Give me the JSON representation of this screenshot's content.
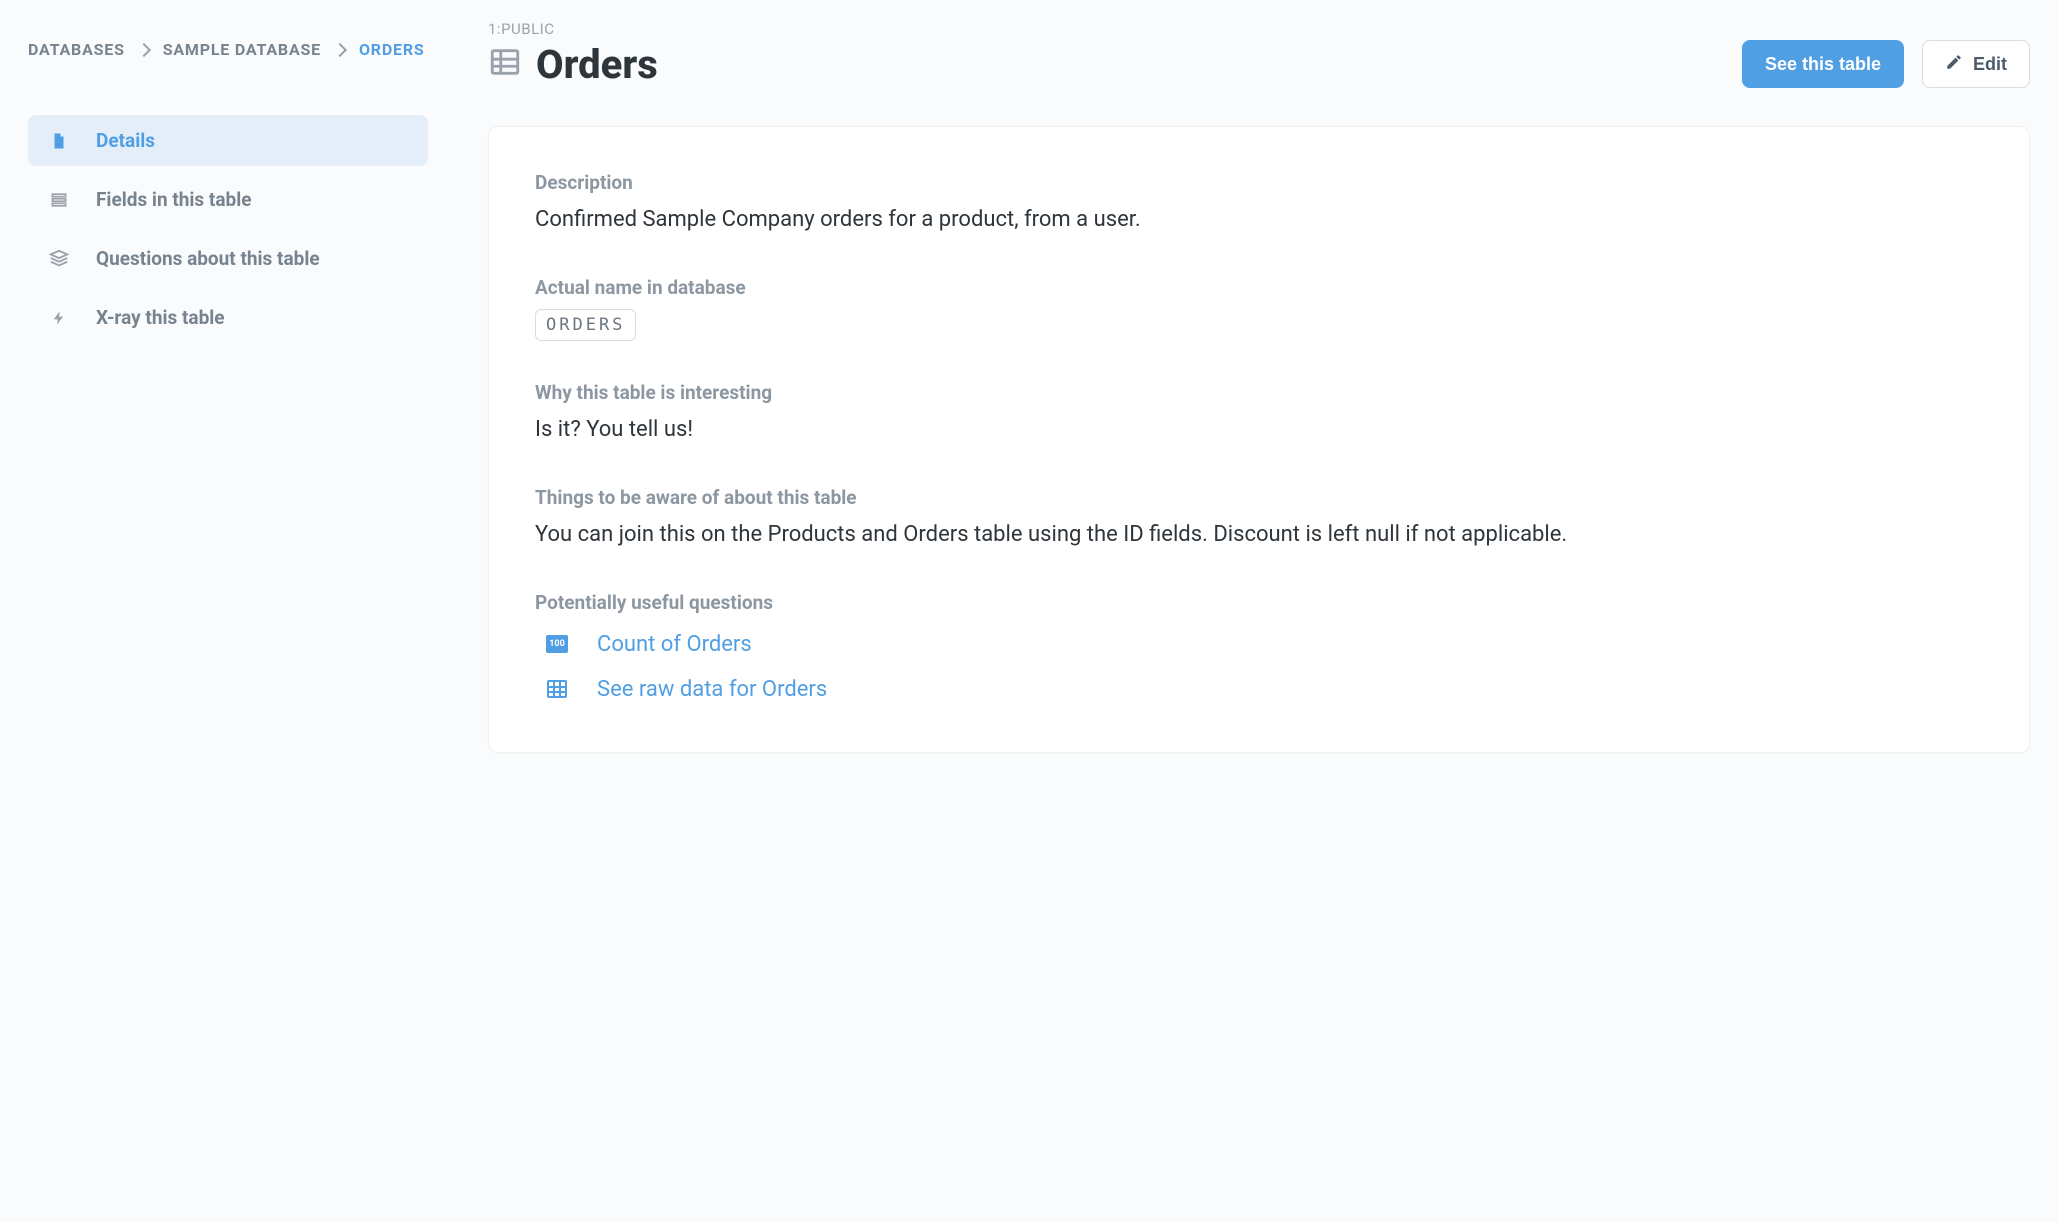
{
  "breadcrumb": {
    "items": [
      {
        "label": "DATABASES"
      },
      {
        "label": "SAMPLE DATABASE"
      },
      {
        "label": "ORDERS"
      }
    ]
  },
  "sidebar": {
    "details": "Details",
    "fields": "Fields in this table",
    "questions": "Questions about this table",
    "xray": "X-ray this table"
  },
  "header": {
    "schema": "1:PUBLIC",
    "title": "Orders",
    "see_table": "See this table",
    "edit": "Edit"
  },
  "details": {
    "description_label": "Description",
    "description_body": "Confirmed Sample Company orders for a product, from a user.",
    "actual_name_label": "Actual name in database",
    "actual_name_value": "ORDERS",
    "why_label": "Why this table is interesting",
    "why_body": "Is it? You tell us!",
    "aware_label": "Things to be aware of about this table",
    "aware_body": "You can join this on the Products and Orders table using the ID fields. Discount is left null if not applicable.",
    "useful_q_label": "Potentially useful questions",
    "questions": [
      {
        "label": "Count of Orders",
        "icon": "100"
      },
      {
        "label": "See raw data for Orders",
        "icon": "table"
      }
    ]
  }
}
